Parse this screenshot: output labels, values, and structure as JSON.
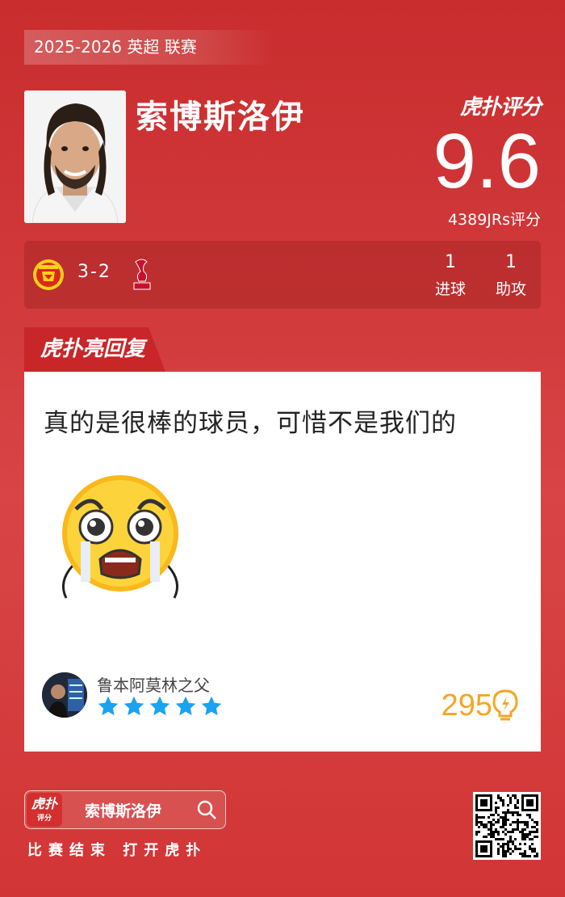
{
  "season": "2025-2026 英超 联赛",
  "player": {
    "name": "索博斯洛伊"
  },
  "brand": {
    "logo_text": "虎扑评分",
    "hl_tab": "虎扑亮回复",
    "mini_logo": "虎扑",
    "mini_logo_sub": "评分"
  },
  "rating": {
    "score": "9.6",
    "count_label": "4389JRs评分"
  },
  "match": {
    "score": "3-2",
    "home_crest": "manchester-united-crest",
    "away_crest": "liverpool-crest",
    "stats": [
      {
        "value": "1",
        "label": "进球"
      },
      {
        "value": "1",
        "label": "助攻"
      }
    ]
  },
  "comment": {
    "text": "真的是很棒的球员，可惜不是我们的",
    "emoji": "crying-face-emoji",
    "user": "鲁本阿莫林之父",
    "stars": 5,
    "likes": "295"
  },
  "footer": {
    "search_text": "索博斯洛伊",
    "cta": "比赛结束 打开虎扑"
  },
  "colors": {
    "background": "#d23a3b",
    "accent_gold": "#f5a623",
    "star_blue": "#1aa3f0"
  }
}
